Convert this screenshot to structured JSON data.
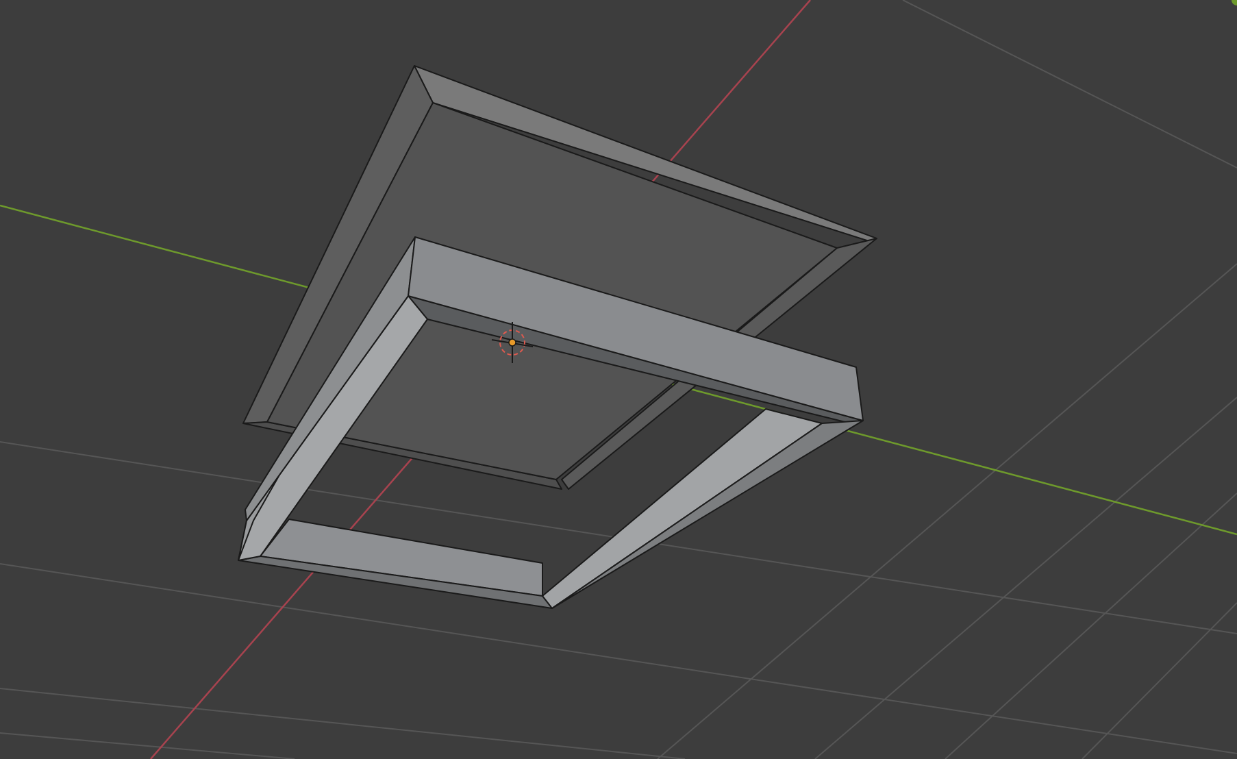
{
  "viewport": {
    "view": "3d-viewport",
    "background_color": "#3d3d3d",
    "grid_line_color": "#5a5a5a",
    "x_axis_color": "#a8434f",
    "y_axis_color": "#6e9a2c",
    "objects": [
      {
        "name": "frame",
        "base_color": "#8a8d90",
        "shape": "hollow-rectangle"
      },
      {
        "name": "panel",
        "base_color": "#545454",
        "shape": "beveled-plane"
      }
    ],
    "origin_marker_color": "#e89a2a",
    "cursor_ring_color": "#e05a4f",
    "edge_color": "#1a1a1a"
  }
}
